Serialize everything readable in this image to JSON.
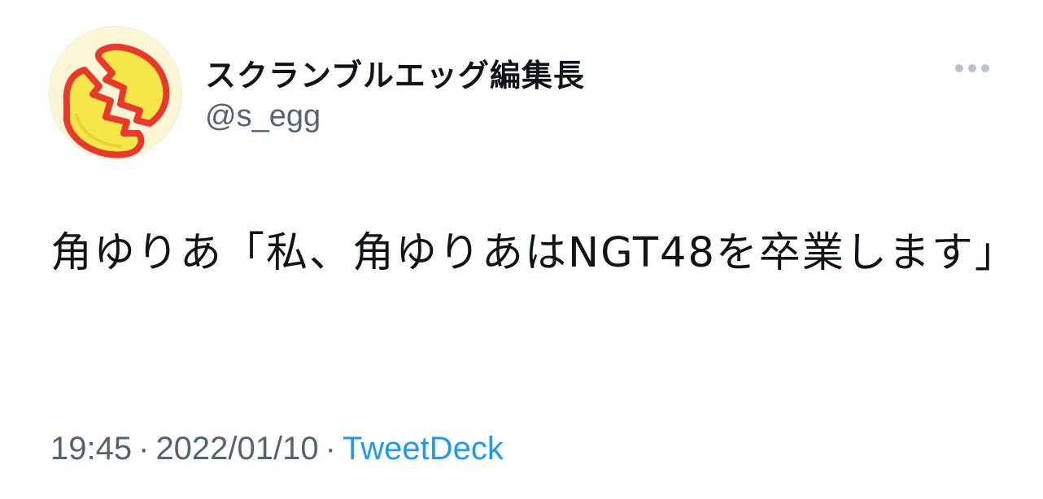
{
  "tweet": {
    "author": {
      "display_name": "スクランブルエッグ編集長",
      "handle": "@s_egg",
      "avatar_icon": "cracked-egg-icon"
    },
    "more_icon": "more-options-icon",
    "text": "角ゆりあ「私、角ゆりあはNGT48を卒業します」",
    "time": "19:45",
    "date": "2022/01/10",
    "separator": "·",
    "source": "TweetDeck"
  },
  "colors": {
    "text_primary": "#0f1419",
    "text_secondary": "#536471",
    "link": "#1d9bf0",
    "avatar_bg": "#fbf6d6",
    "egg_yellow": "#f5e64a",
    "egg_red": "#e8392b"
  }
}
